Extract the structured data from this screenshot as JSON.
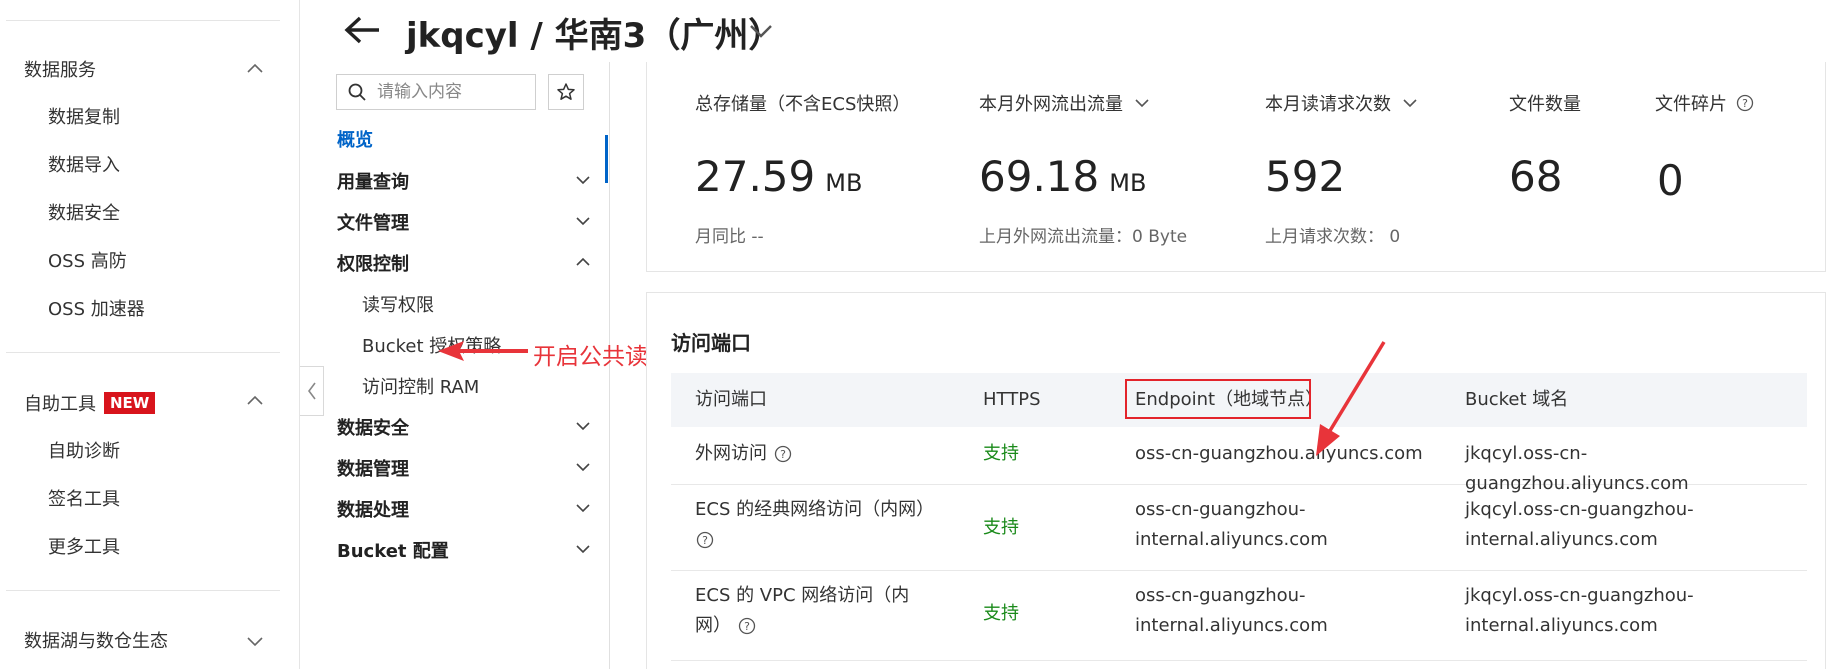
{
  "sidebar": {
    "groups": [
      {
        "label": "数据服务",
        "items": [
          "数据复制",
          "数据导入",
          "数据安全",
          "OSS 高防",
          "OSS 加速器"
        ]
      },
      {
        "label": "自助工具",
        "badge": "NEW",
        "items": [
          "自助诊断",
          "签名工具",
          "更多工具"
        ]
      },
      {
        "label": "数据湖与数仓生态",
        "items": []
      }
    ]
  },
  "header": {
    "title": "jkqcyl / 华南3（广州）"
  },
  "nav": {
    "search_placeholder": "请输入内容",
    "items": [
      {
        "label": "概览"
      },
      {
        "label": "用量查询"
      },
      {
        "label": "文件管理"
      },
      {
        "label": "权限控制",
        "children": [
          "读写权限",
          "Bucket 授权策略",
          "访问控制 RAM"
        ]
      },
      {
        "label": "数据安全"
      },
      {
        "label": "数据管理"
      },
      {
        "label": "数据处理"
      },
      {
        "label": "Bucket 配置"
      }
    ]
  },
  "annotation": {
    "text": "开启公共读"
  },
  "stats": [
    {
      "label": "总存储量（不含ECS快照）",
      "value": "27.59",
      "unit": "MB",
      "sub": "月同比 --"
    },
    {
      "label": "本月外网流出流量",
      "value": "69.18",
      "unit": "MB",
      "sub": "上月外网流出流量：0 Byte"
    },
    {
      "label": "本月读请求次数",
      "value": "592",
      "unit": "",
      "sub": "上月请求次数：  0"
    },
    {
      "label": "文件数量",
      "value": "68",
      "unit": "",
      "sub": ""
    },
    {
      "label": "文件碎片",
      "value": "0",
      "unit": "",
      "sub": ""
    }
  ],
  "access": {
    "title": "访问端口",
    "headers": [
      "访问端口",
      "HTTPS",
      "Endpoint（地域节点）",
      "Bucket 域名"
    ],
    "rows": [
      {
        "port": "外网访问",
        "https": "支持",
        "endpoint": "oss-cn-guangzhou.aliyuncs.com",
        "endpoint2": "",
        "domain": "jkqcyl.oss-cn-guangzhou.aliyuncs.com",
        "domain2": ""
      },
      {
        "port": "ECS 的经典网络访问（内网）",
        "https": "支持",
        "endpoint": "oss-cn-guangzhou-",
        "endpoint2": "internal.aliyuncs.com",
        "domain": "jkqcyl.oss-cn-guangzhou-",
        "domain2": "internal.aliyuncs.com"
      },
      {
        "port": "ECS 的 VPC 网络访问（内",
        "port2": "网）",
        "https": "支持",
        "endpoint": "oss-cn-guangzhou-",
        "endpoint2": "internal.aliyuncs.com",
        "domain": "jkqcyl.oss-cn-guangzhou-",
        "domain2": "internal.aliyuncs.com"
      }
    ]
  },
  "colors": {
    "accent": "#0064c8",
    "annotation": "#e8343a",
    "success": "#1a8a1a",
    "badge": "#d8141c"
  }
}
